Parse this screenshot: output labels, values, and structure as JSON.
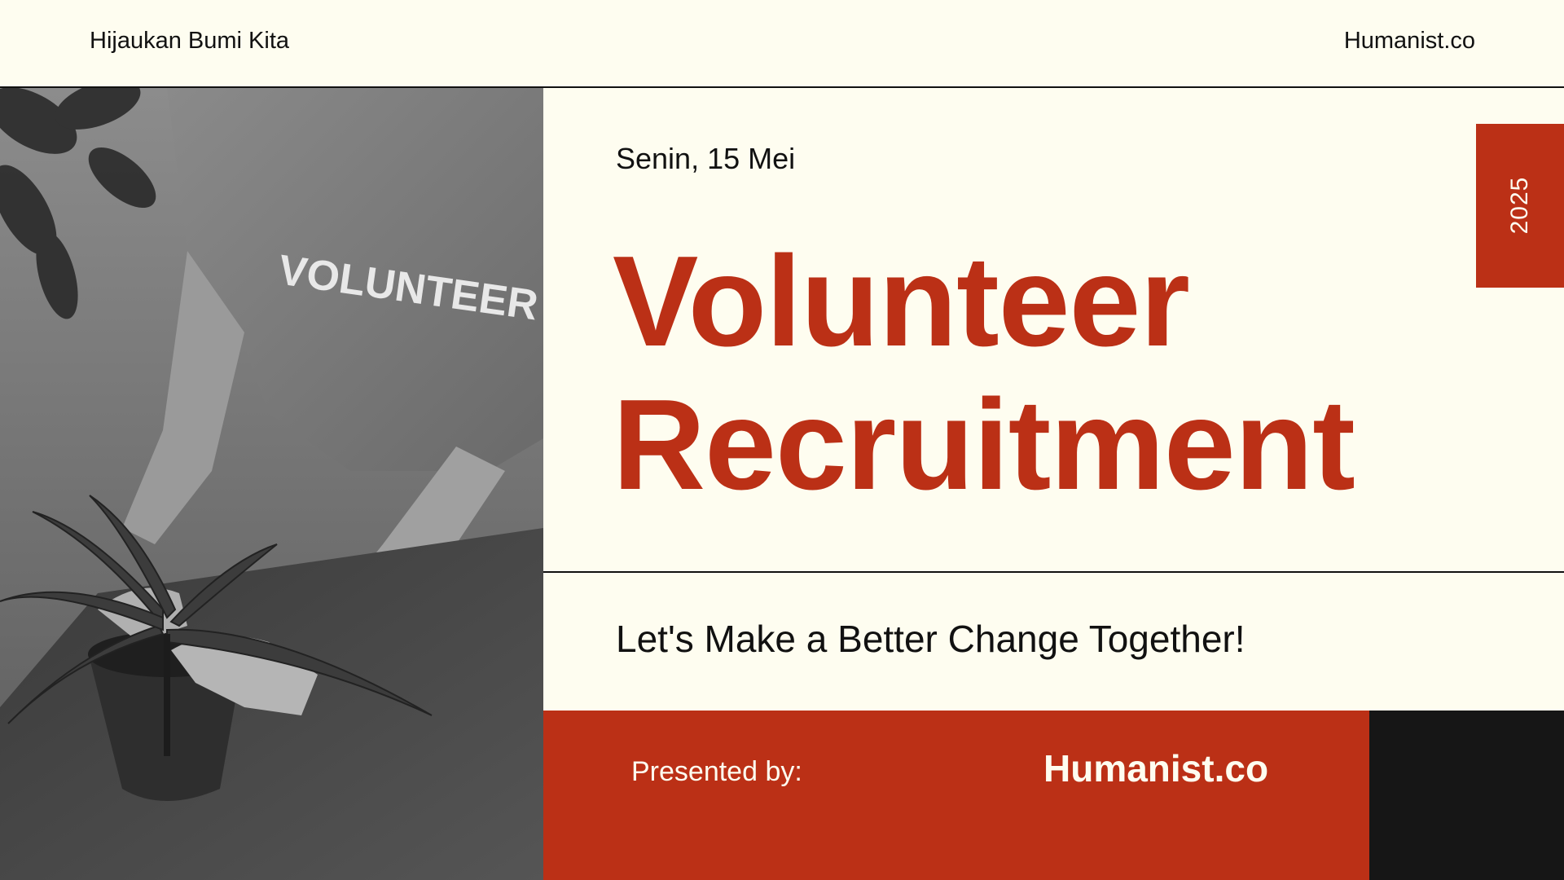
{
  "header": {
    "left_text": "Hijaukan Bumi Kita",
    "right_text": "Humanist.co"
  },
  "photo": {
    "shirt_text": "VOLUNTEER"
  },
  "main": {
    "date": "Senin, 15 Mei",
    "title_line1": "Volunteer",
    "title_line2": "Recruitment",
    "year": "2025",
    "tagline": "Let's Make a Better Change Together!"
  },
  "footer": {
    "presented_label": "Presented by:",
    "brand": "Humanist.co"
  },
  "colors": {
    "background": "#fefdf0",
    "accent": "#bb3016",
    "dark": "#161616",
    "text": "#111111"
  }
}
